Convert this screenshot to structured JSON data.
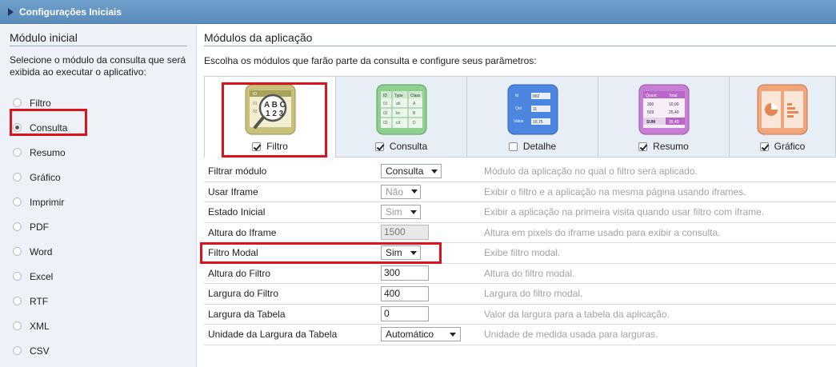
{
  "window": {
    "title": "Configurações Iniciais"
  },
  "sidebar": {
    "title": "Módulo inicial",
    "description": "Selecione o módulo da consulta que será exibida ao executar o aplicativo:",
    "items": [
      {
        "label": "Filtro",
        "checked": false
      },
      {
        "label": "Consulta",
        "checked": true
      },
      {
        "label": "Resumo",
        "checked": false
      },
      {
        "label": "Gráfico",
        "checked": false
      },
      {
        "label": "Imprimir",
        "checked": false
      },
      {
        "label": "PDF",
        "checked": false
      },
      {
        "label": "Word",
        "checked": false
      },
      {
        "label": "Excel",
        "checked": false
      },
      {
        "label": "RTF",
        "checked": false
      },
      {
        "label": "XML",
        "checked": false
      },
      {
        "label": "CSV",
        "checked": false
      }
    ]
  },
  "main": {
    "title": "Módulos da aplicação",
    "description": "Escolha os módulos que farão parte da consulta e configure seus parâmetros:",
    "modules": [
      {
        "label": "Filtro",
        "checked": true,
        "icon": "filter-abc-icon",
        "icon_text": "A B C 1 2 3"
      },
      {
        "label": "Consulta",
        "checked": true,
        "icon": "grid-table-icon",
        "icon_headers": [
          "ID",
          "Type",
          "Class"
        ],
        "icon_rows": [
          [
            "01",
            "ab",
            "A"
          ],
          [
            "02",
            "bc",
            "B"
          ],
          [
            "03",
            "cd",
            "D"
          ]
        ]
      },
      {
        "label": "Detalhe",
        "checked": false,
        "icon": "detail-form-icon",
        "icon_fields": [
          [
            "Id",
            "002"
          ],
          [
            "Qnt",
            "11"
          ],
          [
            "Value",
            "10,75"
          ]
        ]
      },
      {
        "label": "Resumo",
        "checked": true,
        "icon": "summary-table-icon",
        "icon_headers": [
          "Quant.",
          "Total"
        ],
        "icon_rows": [
          [
            "300",
            "10,00"
          ],
          [
            "503",
            "25,40"
          ]
        ],
        "icon_footer": [
          "SUM",
          "35,40"
        ]
      },
      {
        "label": "Gráfico",
        "checked": true,
        "icon": "chart-icon"
      }
    ],
    "params": [
      {
        "label": "Filtrar módulo",
        "type": "select",
        "value": "Consulta",
        "description": "Módulo da aplicação no qual o filtro será aplicado."
      },
      {
        "label": "Usar Iframe",
        "type": "select",
        "value": "Não",
        "description": "Exibir o filtro e a aplicação na mesma página usando iframes."
      },
      {
        "label": "Estado Inicial",
        "type": "select",
        "value": "Sim",
        "description": "Exibir a aplicação na primeira visita quando usar filtro com iframe."
      },
      {
        "label": "Altura do Iframe",
        "type": "input",
        "value": "1500",
        "disabled": true,
        "description": "Altura em pixels do iframe usado para exibir a consulta."
      },
      {
        "label": "Filtro Modal",
        "type": "select",
        "value": "Sim",
        "description": "Exibe filtro modal."
      },
      {
        "label": "Altura do Filtro",
        "type": "input",
        "value": "300",
        "description": "Altura do filtro modal."
      },
      {
        "label": "Largura do Filtro",
        "type": "input",
        "value": "400",
        "description": "Largura do filtro modal."
      },
      {
        "label": "Largura da Tabela",
        "type": "input",
        "value": "0",
        "description": "Valor da largura para a tabela da aplicação."
      },
      {
        "label": "Unidade da Largura da Tabela",
        "type": "select",
        "value": "Automático",
        "description": "Unidade de medida usada para larguras."
      }
    ]
  },
  "colors": {
    "titlebar": "#6f9fcb",
    "highlight": "#d9151b",
    "sidebar_bg": "#eef2f8"
  }
}
